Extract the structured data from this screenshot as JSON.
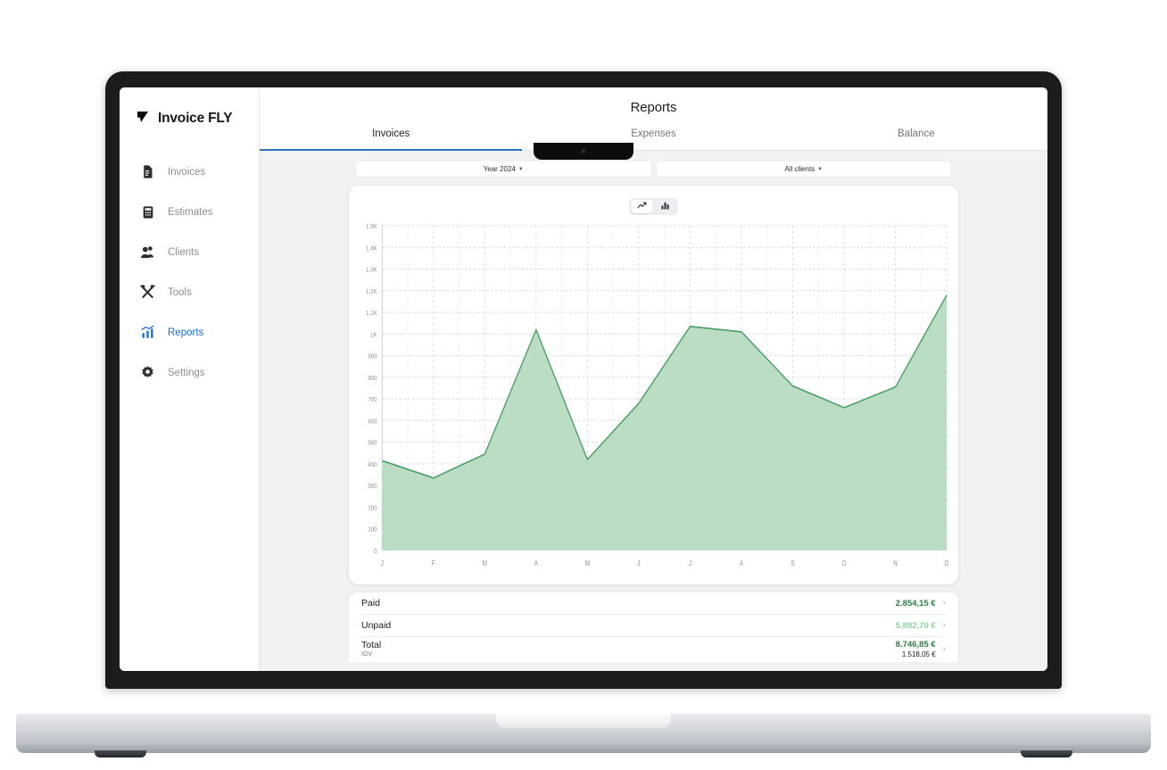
{
  "app": {
    "brand": "Invoice FLY",
    "brand_logo_icon": "paper-plane-icon"
  },
  "sidebar": {
    "items": [
      {
        "label": "Invoices",
        "icon": "document-icon",
        "active": false
      },
      {
        "label": "Estimates",
        "icon": "calculator-icon",
        "active": false
      },
      {
        "label": "Clients",
        "icon": "people-icon",
        "active": false
      },
      {
        "label": "Tools",
        "icon": "tools-icon",
        "active": false
      },
      {
        "label": "Reports",
        "icon": "bar-chart-icon",
        "active": true
      },
      {
        "label": "Settings",
        "icon": "gear-icon",
        "active": false
      }
    ]
  },
  "header": {
    "title": "Reports",
    "tabs": [
      {
        "label": "Invoices",
        "active": true
      },
      {
        "label": "Expenses",
        "active": false
      },
      {
        "label": "Balance",
        "active": false
      }
    ]
  },
  "filters": [
    {
      "label": "Year 2024",
      "icon": "chevron-down-icon"
    },
    {
      "label": "All clients",
      "icon": "chevron-down-icon"
    }
  ],
  "chart_toggle": [
    {
      "icon": "line-chart-icon",
      "active": true
    },
    {
      "icon": "bar-chart-icon",
      "active": false
    }
  ],
  "chart_data": {
    "type": "area",
    "title": "",
    "xlabel": "",
    "ylabel": "",
    "categories": [
      "J",
      "F",
      "M",
      "A",
      "M",
      "J",
      "J",
      "A",
      "S",
      "O",
      "N",
      "D"
    ],
    "series": [
      {
        "name": "Invoices",
        "values": [
          415,
          335,
          445,
          1020,
          420,
          680,
          1035,
          1010,
          760,
          660,
          755,
          1180
        ]
      }
    ],
    "ylim": [
      0,
      1500
    ],
    "yticks": [
      0,
      100,
      200,
      300,
      400,
      500,
      600,
      700,
      800,
      900,
      1000,
      1100,
      1200,
      1300,
      1400,
      1500
    ],
    "ytick_labels": [
      "0",
      "100",
      "200",
      "300",
      "400",
      "500",
      "600",
      "700",
      "800",
      "900",
      "1K",
      "1.1K",
      "1.2K",
      "1.3K",
      "1.4K",
      "1.5K"
    ],
    "grid": true,
    "legend": "none",
    "line_color": "#4a9e63",
    "fill_color": "#b6dbc0"
  },
  "summary": {
    "rows": [
      {
        "label": "Paid",
        "sub": "",
        "value": "2.854,15 €",
        "value2": "",
        "color": "#2e7d46",
        "chevron": "chevron-right-icon"
      },
      {
        "label": "Unpaid",
        "sub": "",
        "value": "5.892,70 €",
        "value2": "",
        "color": "#8fd4a4",
        "chevron": "chevron-right-icon"
      },
      {
        "label": "Total",
        "sub": "IGV",
        "value": "8.746,85 €",
        "value2": "1.518,05 €",
        "color": "#2e7d46",
        "chevron": "chevron-right-icon"
      }
    ]
  },
  "colors": {
    "accent_blue": "#1a6fe0",
    "tab_underline": "#2f6fc0",
    "page_bg": "#f2f2f2"
  }
}
